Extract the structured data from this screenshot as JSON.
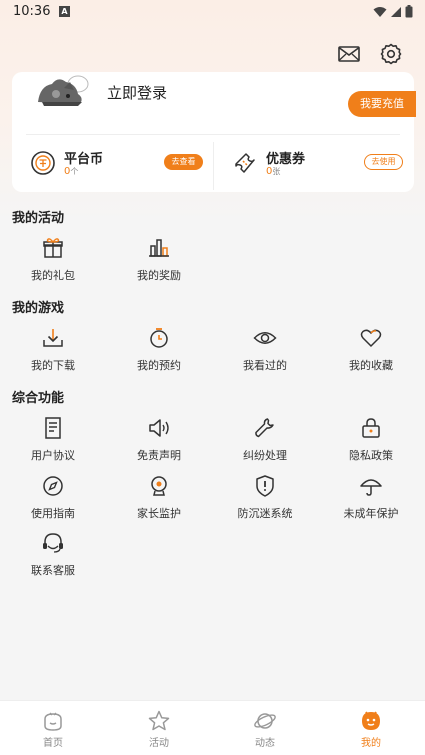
{
  "status_bar": {
    "time": "10:36",
    "notif_badge": "A"
  },
  "header": {
    "icons": [
      "mail-icon",
      "settings-icon"
    ]
  },
  "profile": {
    "login_label": "立即登录",
    "recharge_label": "我要充值"
  },
  "wallet": {
    "platform_coin": {
      "title": "平台币",
      "count": "0",
      "unit": "个",
      "action": "去查看"
    },
    "coupon": {
      "title": "优惠券",
      "count": "0",
      "unit": "张",
      "action": "去使用"
    }
  },
  "sections": {
    "activities": {
      "title": "我的活动",
      "items": [
        {
          "label": "我的礼包",
          "icon": "gift-icon"
        },
        {
          "label": "我的奖励",
          "icon": "award-bars-icon"
        }
      ]
    },
    "games": {
      "title": "我的游戏",
      "items": [
        {
          "label": "我的下载",
          "icon": "download-icon"
        },
        {
          "label": "我的预约",
          "icon": "alarm-clock-icon"
        },
        {
          "label": "我看过的",
          "icon": "eye-icon"
        },
        {
          "label": "我的收藏",
          "icon": "heart-icon"
        }
      ]
    },
    "general": {
      "title": "综合功能",
      "items": [
        {
          "label": "用户协议",
          "icon": "document-icon"
        },
        {
          "label": "免责声明",
          "icon": "speaker-icon"
        },
        {
          "label": "纠纷处理",
          "icon": "wrench-icon"
        },
        {
          "label": "隐私政策",
          "icon": "lock-icon"
        },
        {
          "label": "使用指南",
          "icon": "compass-icon"
        },
        {
          "label": "家长监护",
          "icon": "webcam-icon"
        },
        {
          "label": "防沉迷系统",
          "icon": "shield-alert-icon"
        },
        {
          "label": "未成年保护",
          "icon": "umbrella-icon"
        },
        {
          "label": "联系客服",
          "icon": "headset-icon"
        }
      ]
    }
  },
  "bottom_nav": {
    "active": "我的",
    "items": [
      {
        "label": "首页",
        "icon": "home-icon"
      },
      {
        "label": "活动",
        "icon": "star-icon"
      },
      {
        "label": "动态",
        "icon": "planet-icon"
      },
      {
        "label": "我的",
        "icon": "mine-face-icon"
      }
    ]
  },
  "colors": {
    "accent": "#f07f1a",
    "background": "#f5f5f5",
    "card": "#ffffff"
  }
}
